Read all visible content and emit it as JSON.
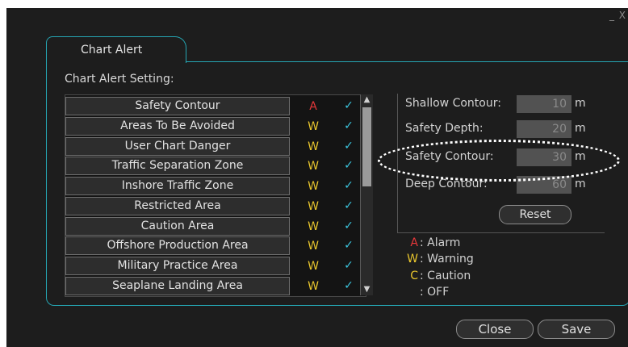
{
  "window": {
    "controls": "_ X"
  },
  "tab": {
    "label": "Chart Alert"
  },
  "setting_title": "Chart Alert Setting:",
  "alerts": [
    {
      "name": "Safety Contour",
      "type": "A",
      "check": "✓"
    },
    {
      "name": "Areas To Be Avoided",
      "type": "W",
      "check": "✓"
    },
    {
      "name": "User Chart Danger",
      "type": "W",
      "check": "✓"
    },
    {
      "name": "Traffic Separation Zone",
      "type": "W",
      "check": "✓"
    },
    {
      "name": "Inshore Traffic Zone",
      "type": "W",
      "check": "✓"
    },
    {
      "name": "Restricted Area",
      "type": "W",
      "check": "✓"
    },
    {
      "name": "Caution Area",
      "type": "W",
      "check": "✓"
    },
    {
      "name": "Offshore Production Area",
      "type": "W",
      "check": "✓"
    },
    {
      "name": "Military Practice Area",
      "type": "W",
      "check": "✓"
    },
    {
      "name": "Seaplane Landing Area",
      "type": "W",
      "check": "✓"
    }
  ],
  "scroll": {
    "up": "▲",
    "down": "▼"
  },
  "contours": [
    {
      "label": "Shallow Contour:",
      "value": "10",
      "unit": "m"
    },
    {
      "label": "Safety Depth:",
      "value": "20",
      "unit": "m"
    },
    {
      "label": "Safety Contour:",
      "value": "30",
      "unit": "m"
    },
    {
      "label": "Deep Contour:",
      "value": "60",
      "unit": "m"
    }
  ],
  "reset_label": "Reset",
  "legend": [
    {
      "symbol": "A",
      "text": ": Alarm"
    },
    {
      "symbol": "W",
      "text": ": Warning"
    },
    {
      "symbol": "C",
      "text": ": Caution"
    },
    {
      "symbol": "",
      "text": ": OFF"
    }
  ],
  "footer": {
    "close_label": "Close",
    "save_label": "Save"
  },
  "colors": {
    "accent": "#25a6b3",
    "alarm": "#e8383a",
    "warning": "#e9c62d",
    "check": "#3cc7e0",
    "background": "#1d1d1d"
  }
}
